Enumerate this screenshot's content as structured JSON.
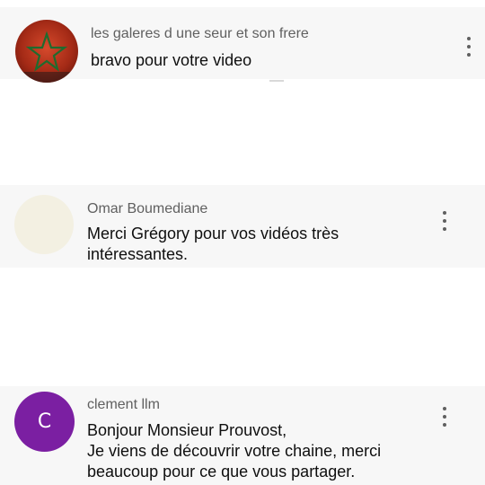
{
  "comments": [
    {
      "author": "les galeres d une seur et son frere",
      "text_lines": [
        "bravo pour votre video"
      ],
      "avatar": {
        "type": "image",
        "icon": "moroccan-flag-avatar-icon",
        "bg": "#b5321d"
      }
    },
    {
      "author": "Omar Boumediane",
      "text_lines": [
        "Merci Grégory pour vos vidéos très",
        "intéressantes."
      ],
      "avatar": {
        "type": "blank",
        "icon": "blank-avatar-icon",
        "bg": "#f3f0e2"
      }
    },
    {
      "author": "clement llm",
      "text_lines": [
        "Bonjour Monsieur Prouvost,",
        "Je viens de découvrir votre chaine, merci",
        "beaucoup pour ce que vous partager."
      ],
      "avatar": {
        "type": "letter",
        "letter": "C",
        "icon": "letter-avatar-icon",
        "bg": "#7b1fa2"
      }
    }
  ],
  "menu_icon": "more-vertical-icon"
}
